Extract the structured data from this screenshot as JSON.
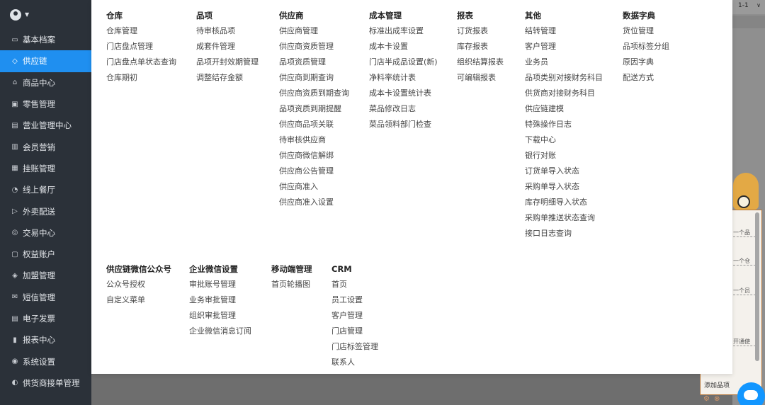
{
  "sidebar": {
    "items": [
      {
        "icon": "archive-icon",
        "label": "基本档案"
      },
      {
        "icon": "supply-chain-icon",
        "label": "供应链",
        "active": true
      },
      {
        "icon": "product-icon",
        "label": "商品中心"
      },
      {
        "icon": "retail-icon",
        "label": "零售管理"
      },
      {
        "icon": "business-icon",
        "label": "营业管理中心"
      },
      {
        "icon": "member-icon",
        "label": "会员营销"
      },
      {
        "icon": "account-icon",
        "label": "挂账管理"
      },
      {
        "icon": "restaurant-icon",
        "label": "线上餐厅"
      },
      {
        "icon": "delivery-icon",
        "label": "外卖配送"
      },
      {
        "icon": "trade-icon",
        "label": "交易中心"
      },
      {
        "icon": "rights-icon",
        "label": "权益账户"
      },
      {
        "icon": "franchise-icon",
        "label": "加盟管理"
      },
      {
        "icon": "sms-icon",
        "label": "短信管理"
      },
      {
        "icon": "invoice-icon",
        "label": "电子发票"
      },
      {
        "icon": "report-icon",
        "label": "报表中心"
      },
      {
        "icon": "settings-icon",
        "label": "系统设置"
      },
      {
        "icon": "supplier-order-icon",
        "label": "供货商接单管理"
      }
    ]
  },
  "menu": {
    "row1": [
      {
        "title": "仓库",
        "items": [
          "仓库管理",
          "门店盘点管理",
          "门店盘点单状态查询",
          "仓库期初"
        ]
      },
      {
        "title": "品项",
        "items": [
          "待审核品项",
          "成套件管理",
          "品项开封效期管理",
          "调整结存金额"
        ]
      },
      {
        "title": "供应商",
        "items": [
          "供应商管理",
          "供应商资质管理",
          "品项资质管理",
          "供应商到期查询",
          "供应商资质到期查询",
          "品项资质到期提醒",
          "供应商品项关联",
          "待审核供应商",
          "供应商微信解绑",
          "供应商公告管理",
          "供应商准入",
          "供应商准入设置"
        ]
      },
      {
        "title": "成本管理",
        "items": [
          "标准出成率设置",
          "成本卡设置",
          "门店半成品设置(新)",
          "净料率统计表",
          "成本卡设置统计表",
          "菜品修改日志",
          "菜品领料部门检查"
        ]
      },
      {
        "title": "报表",
        "items": [
          "订货报表",
          "库存报表",
          "组织结算报表",
          "可编辑报表"
        ]
      },
      {
        "title": "其他",
        "items": [
          "结转管理",
          "客户管理",
          "业务员",
          "品项类别对接财务科目",
          "供货商对接财务科目",
          "供应链建模",
          "特殊操作日志",
          "下载中心",
          "银行对账",
          "订货单导入状态",
          "采购单导入状态",
          "库存明细导入状态",
          "采购单推送状态查询",
          "接口日志查询"
        ]
      },
      {
        "title": "数据字典",
        "items": [
          "货位管理",
          "品项标签分组",
          "原因字典",
          "配送方式"
        ]
      }
    ],
    "row2": [
      {
        "title": "供应链微信公众号",
        "items": [
          "公众号授权",
          "自定义菜单"
        ]
      },
      {
        "title": "企业微信设置",
        "items": [
          "审批账号管理",
          "业务审批管理",
          "组织审批管理",
          "企业微信消息订阅"
        ]
      },
      {
        "title": "移动端管理",
        "items": [
          "首页轮播图"
        ]
      },
      {
        "title": "CRM",
        "items": [
          "首页",
          "员工设置",
          "客户管理",
          "门店管理",
          "门店标签管理",
          "联系人"
        ]
      }
    ]
  },
  "right_panel": {
    "top_select_value": "1-1",
    "fragments": [
      "一个品",
      "一个仓",
      "一个员",
      "开通使"
    ],
    "add_link": "添加品项"
  }
}
